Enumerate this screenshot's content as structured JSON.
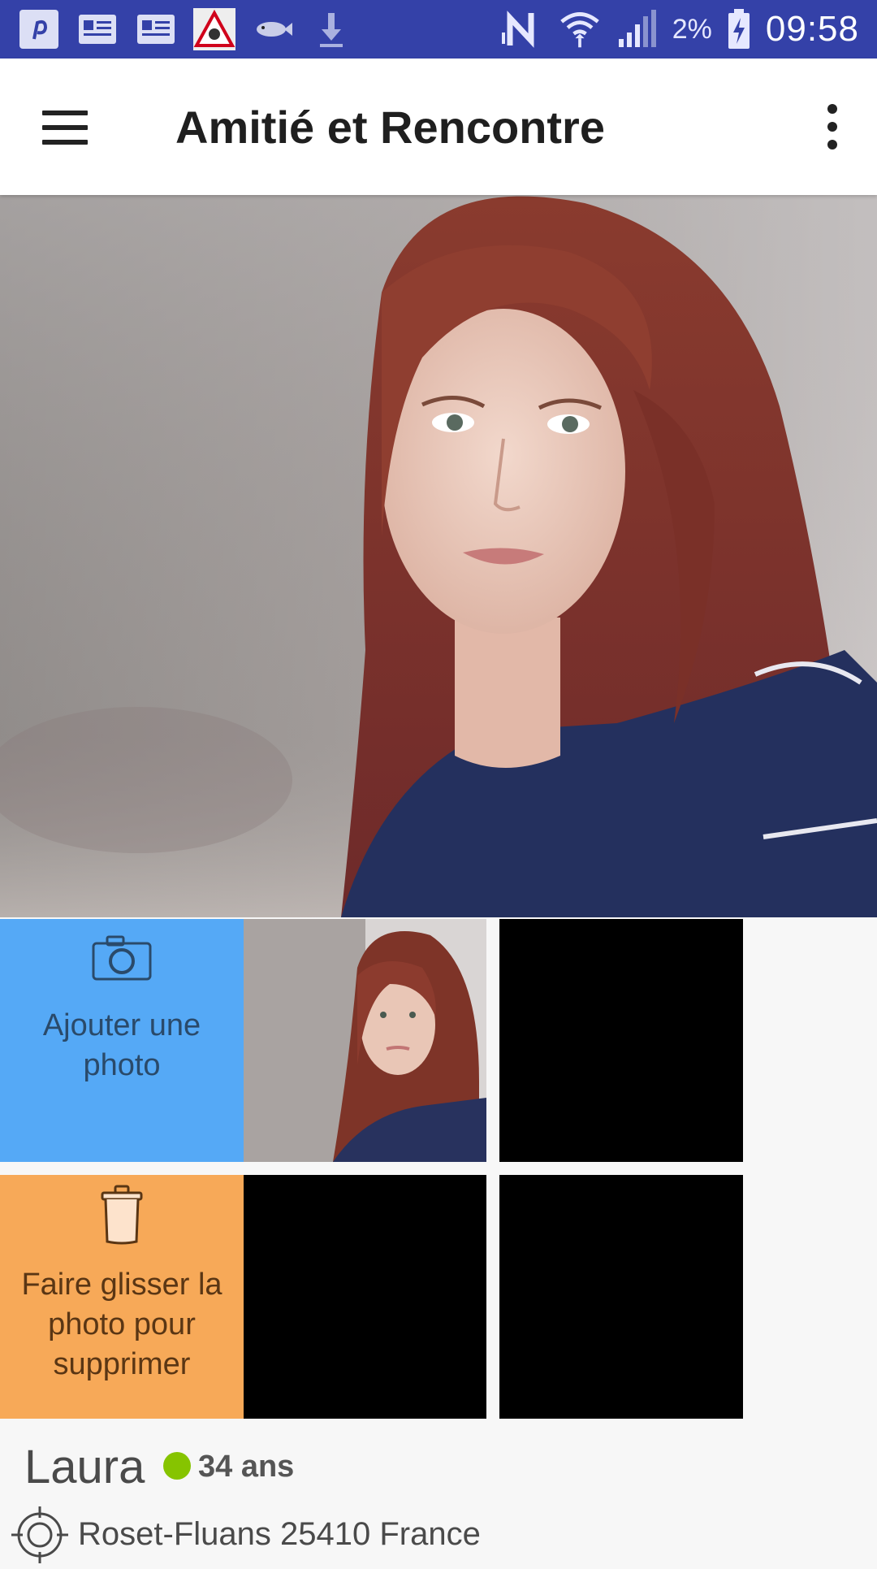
{
  "status_bar": {
    "left_icons": [
      "pinterest-notification-icon",
      "news-notification-icon",
      "news-notification-icon",
      "warning-notification-icon",
      "fish-notification-icon",
      "download-notification-icon"
    ],
    "right_icons": [
      "nfc-icon",
      "wifi-icon",
      "signal-icon",
      "battery-charging-icon"
    ],
    "battery": "2%",
    "time": "09:58",
    "bg_color": "#3441a8"
  },
  "app_bar": {
    "title": "Amitié et Rencontre",
    "menu_icon": "hamburger-menu-icon",
    "overflow_icon": "more-vertical-icon"
  },
  "photos": {
    "add_label": "Ajouter une photo",
    "add_icon": "camera-icon",
    "add_color": "#55a9f6",
    "delete_label": "Faire glisser la photo pour supprimer",
    "delete_icon": "trash-icon",
    "delete_color": "#f7a958",
    "empty_slots": 3
  },
  "profile": {
    "name": "Laura",
    "status": "online",
    "status_color": "#86c400",
    "age": "34 ans",
    "location": "Roset-Fluans 25410 France",
    "location_icon": "crosshair-location-icon"
  }
}
